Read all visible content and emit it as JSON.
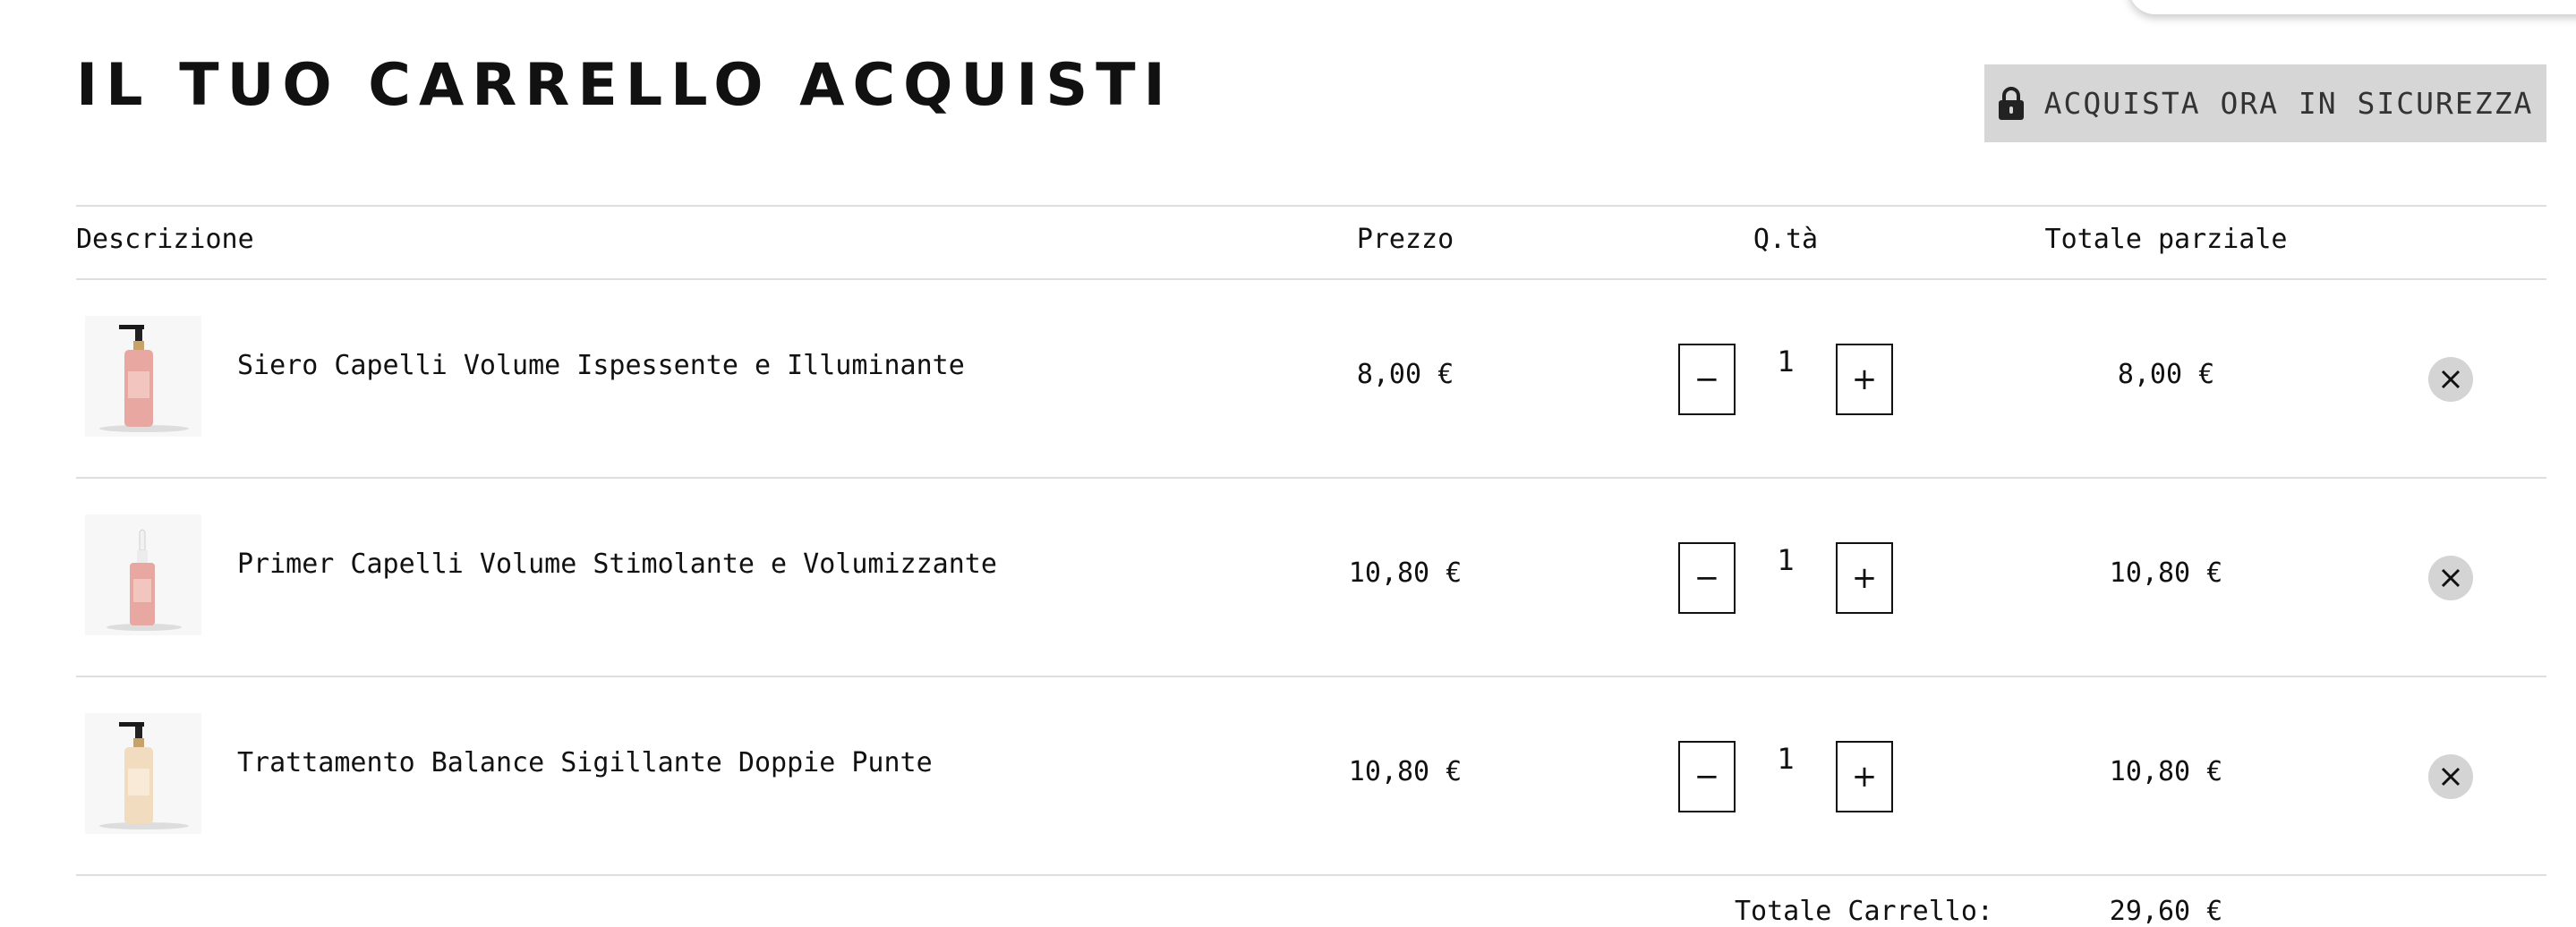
{
  "page": {
    "title": "IL TUO CARRELLO ACQUISTI"
  },
  "checkout": {
    "label": "ACQUISTA ORA IN SICUREZZA",
    "icon": "lock-icon"
  },
  "table": {
    "headers": {
      "description": "Descrizione",
      "price": "Prezzo",
      "quantity": "Q.tà",
      "subtotal": "Totale parziale"
    },
    "items": [
      {
        "name": "Siero Capelli Volume Ispessente e Illuminante",
        "price": "8,00 €",
        "qty": "1",
        "subtotal": "8,00 €"
      },
      {
        "name": "Primer Capelli Volume Stimolante e Volumizzante",
        "price": "10,80 €",
        "qty": "1",
        "subtotal": "10,80 €"
      },
      {
        "name": "Trattamento Balance Sigillante Doppie Punte",
        "price": "10,80 €",
        "qty": "1",
        "subtotal": "10,80 €"
      }
    ],
    "qty_minus_label": "−",
    "qty_plus_label": "+"
  },
  "totals": {
    "label": "Totale Carrello:",
    "value": "29,60 €"
  },
  "colors": {
    "checkout_button_bg": "#d6d6d6",
    "rule": "#dedede",
    "remove_button_bg": "#d4d4d4",
    "product_pink": "#e8a7a0",
    "product_cream": "#f2dcc0"
  }
}
